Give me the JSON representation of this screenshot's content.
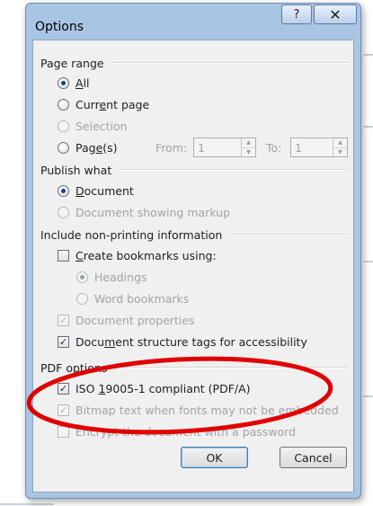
{
  "dialog": {
    "title": "Options",
    "help_glyph": "?",
    "close_glyph": "✕"
  },
  "page_range": {
    "header": "Page range",
    "all": {
      "pre": "",
      "u": "A",
      "post": "ll"
    },
    "current_page": {
      "pre": "Curr",
      "u": "e",
      "post": "nt page"
    },
    "selection": "Selection",
    "pages": {
      "pre": "Pag",
      "u": "e",
      "post": "(s)"
    },
    "from_label": "From:",
    "from_value": "1",
    "to_label": "To:",
    "to_value": "1"
  },
  "publish_what": {
    "header": "Publish what",
    "document": {
      "pre": "",
      "u": "D",
      "post": "ocument"
    },
    "document_markup": "Document showing markup"
  },
  "non_printing": {
    "header": "Include non-printing information",
    "create_bookmarks": {
      "pre": "",
      "u": "C",
      "post": "reate bookmarks using:"
    },
    "headings": "Headings",
    "word_bookmarks": "Word bookmarks",
    "document_properties": "Document properties",
    "structure_tags": {
      "pre": "Docu",
      "u": "m",
      "post": "ent structure tags for accessibility"
    }
  },
  "pdf_options": {
    "header": "PDF options",
    "iso": {
      "pre": "ISO ",
      "u": "1",
      "post": "9005-1 compliant (PDF/A)"
    },
    "bitmap_text": "Bitmap text when fonts may not be embedded",
    "encrypt": "Encrypt the document with a password"
  },
  "buttons": {
    "ok": "OK",
    "cancel": "Cancel"
  },
  "colors": {
    "annotation_ellipse": "#e10000",
    "window_frame": "#a9c5e4",
    "client_background": "#f0f0f0"
  }
}
